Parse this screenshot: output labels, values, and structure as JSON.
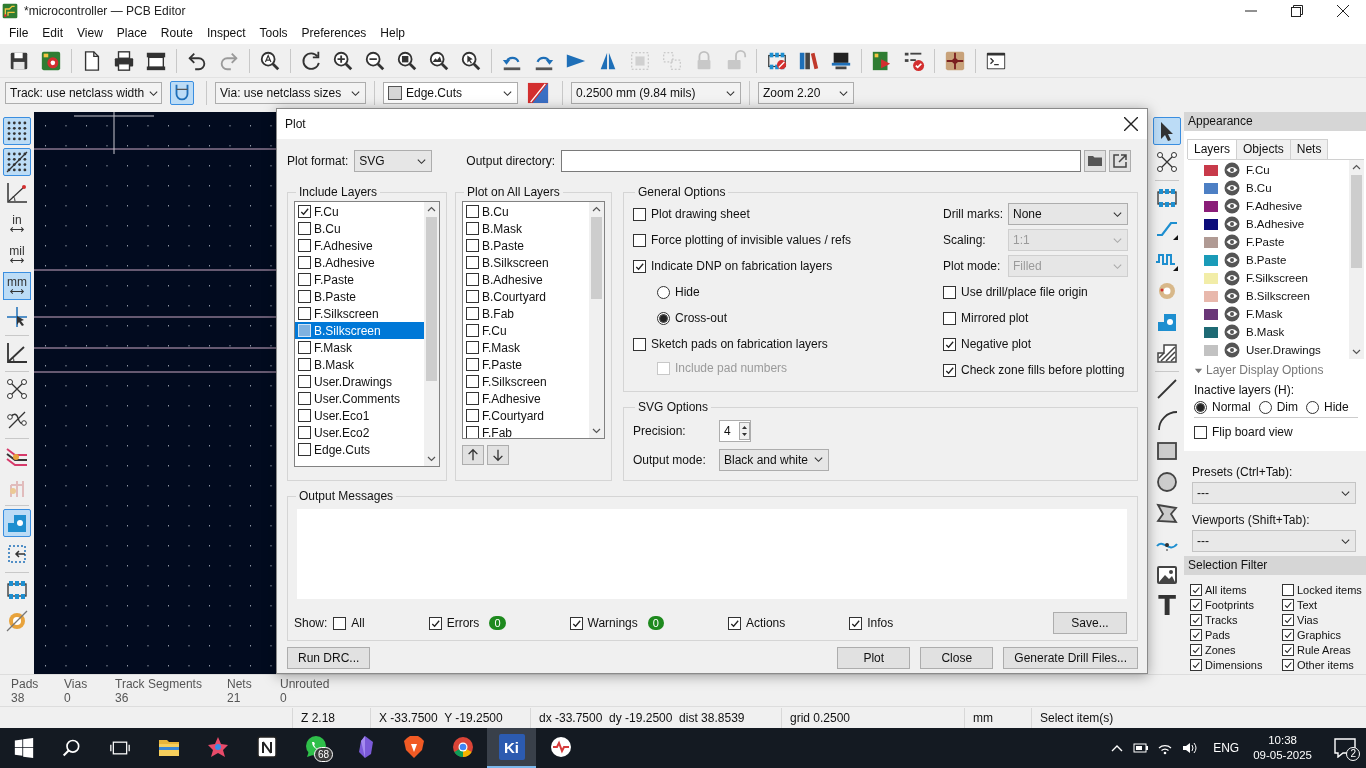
{
  "window": {
    "title": "*microcontroller — PCB Editor"
  },
  "menu": [
    "File",
    "Edit",
    "View",
    "Place",
    "Route",
    "Inspect",
    "Tools",
    "Preferences",
    "Help"
  ],
  "main_toolbar": {
    "groups": [
      {
        "tools": [
          {
            "kind": "save",
            "disabled": false
          },
          {
            "kind": "board-setup",
            "disabled": false
          }
        ]
      },
      {
        "tools": [
          {
            "kind": "page",
            "disabled": false
          },
          {
            "kind": "print",
            "disabled": false
          },
          {
            "kind": "plot",
            "disabled": false
          }
        ]
      },
      {
        "tools": [
          {
            "kind": "undo",
            "disabled": false
          },
          {
            "kind": "redo",
            "disabled": true
          }
        ]
      },
      {
        "tools": [
          {
            "kind": "find",
            "disabled": false
          }
        ]
      },
      {
        "tools": [
          {
            "kind": "refresh",
            "disabled": false
          },
          {
            "kind": "zoom-in",
            "disabled": false
          },
          {
            "kind": "zoom-out",
            "disabled": false
          },
          {
            "kind": "zoom-fit",
            "disabled": false
          },
          {
            "kind": "zoom-objects",
            "disabled": false
          },
          {
            "kind": "zoom-selection",
            "disabled": false
          }
        ]
      },
      {
        "tools": [
          {
            "kind": "rotate-ccw",
            "disabled": false
          },
          {
            "kind": "rotate-cw",
            "disabled": false
          },
          {
            "kind": "flip",
            "disabled": false
          },
          {
            "kind": "mirror",
            "disabled": false
          },
          {
            "kind": "group",
            "disabled": true
          },
          {
            "kind": "ungroup",
            "disabled": true
          },
          {
            "kind": "lock",
            "disabled": true
          },
          {
            "kind": "unlock",
            "disabled": true
          }
        ]
      },
      {
        "tools": [
          {
            "kind": "footprint-editor",
            "disabled": false
          },
          {
            "kind": "library",
            "disabled": false
          },
          {
            "kind": "board-3d",
            "disabled": false
          }
        ]
      },
      {
        "tools": [
          {
            "kind": "update",
            "disabled": false
          },
          {
            "kind": "drc",
            "disabled": false
          }
        ]
      },
      {
        "tools": [
          {
            "kind": "net",
            "disabled": false
          }
        ]
      },
      {
        "tools": [
          {
            "kind": "terminal",
            "disabled": false
          }
        ]
      }
    ]
  },
  "options_bar": {
    "track_width": "Track: use netclass width",
    "posture_on": true,
    "via_size": "Via: use netclass sizes",
    "layer": "Edge.Cuts",
    "grid": "0.2500 mm (9.84 mils)",
    "zoom": "Zoom 2.20"
  },
  "left_toolbar": {
    "groups": [
      {
        "tools": [
          {
            "kind": "grid",
            "on": true
          },
          {
            "kind": "grid-override",
            "on": true
          },
          {
            "kind": "polar",
            "on": false
          },
          {
            "kind": "unit",
            "label": "in",
            "on": false
          },
          {
            "kind": "unit",
            "label": "mil",
            "on": false
          },
          {
            "kind": "unit",
            "label": "mm",
            "on": true
          },
          {
            "kind": "crosshair",
            "on": false
          }
        ]
      },
      {
        "tools": [
          {
            "kind": "angle",
            "on": false
          }
        ]
      },
      {
        "tools": [
          {
            "kind": "ratsnest",
            "on": false
          },
          {
            "kind": "curved-ratsnest",
            "on": false
          }
        ]
      },
      {
        "tools": [
          {
            "kind": "net-colors",
            "on": false
          },
          {
            "kind": "tracks-faded",
            "on": false
          }
        ]
      },
      {
        "tools": [
          {
            "kind": "pads",
            "on": true
          },
          {
            "kind": "selection-box",
            "on": false
          }
        ]
      },
      {
        "tools": [
          {
            "kind": "footprint-outline",
            "on": false
          },
          {
            "kind": "via-outline",
            "on": false
          }
        ]
      }
    ]
  },
  "right_toolbar": {
    "groups": [
      {
        "tools": [
          {
            "kind": "select",
            "on": true
          },
          {
            "kind": "local-ratsnest",
            "on": false
          }
        ]
      },
      {
        "tools": [
          {
            "kind": "footprint",
            "on": false
          },
          {
            "kind": "route",
            "on": false
          },
          {
            "kind": "tune",
            "on": false
          },
          {
            "kind": "via",
            "on": false
          },
          {
            "kind": "pad",
            "on": false
          },
          {
            "kind": "zone",
            "on": false
          }
        ]
      },
      {
        "tools": [
          {
            "kind": "line",
            "on": false
          },
          {
            "kind": "arc",
            "on": false
          },
          {
            "kind": "rect",
            "on": false
          },
          {
            "kind": "circle",
            "on": false
          },
          {
            "kind": "polygon",
            "on": false
          },
          {
            "kind": "bezier",
            "on": false
          },
          {
            "kind": "image",
            "on": false
          },
          {
            "kind": "text",
            "label": "T",
            "on": false
          }
        ]
      }
    ]
  },
  "appearance": {
    "title": "Appearance",
    "tabs": [
      {
        "label": "Layers",
        "selected": true
      },
      {
        "label": "Objects",
        "selected": false
      },
      {
        "label": "Nets",
        "selected": false
      }
    ],
    "layers": [
      {
        "name": "F.Cu",
        "color": "#c83a4a",
        "visible": true
      },
      {
        "name": "B.Cu",
        "color": "#4d7fc4",
        "visible": true
      },
      {
        "name": "F.Adhesive",
        "color": "#8a1d78",
        "visible": true
      },
      {
        "name": "B.Adhesive",
        "color": "#0c0c7a",
        "visible": true
      },
      {
        "name": "F.Paste",
        "color": "#b09a94",
        "visible": true
      },
      {
        "name": "B.Paste",
        "color": "#1a9bb8",
        "visible": true
      },
      {
        "name": "F.Silkscreen",
        "color": "#f2eda8",
        "visible": true
      },
      {
        "name": "B.Silkscreen",
        "color": "#e8b8ac",
        "visible": true
      },
      {
        "name": "F.Mask",
        "color": "#6a3778",
        "visible": true
      },
      {
        "name": "B.Mask",
        "color": "#1e6a74",
        "visible": true
      },
      {
        "name": "User.Drawings",
        "color": "#c2c2c2",
        "visible": true
      }
    ],
    "display_options": {
      "title": "Layer Display Options",
      "expanded": true,
      "inactive_label": "Inactive layers (H):",
      "inactive_modes": [
        {
          "label": "Normal",
          "selected": true
        },
        {
          "label": "Dim",
          "selected": false
        },
        {
          "label": "Hide",
          "selected": false
        }
      ],
      "flip": {
        "label": "Flip board view",
        "checked": false
      }
    },
    "presets": {
      "label": "Presets (Ctrl+Tab):",
      "value": "---"
    },
    "viewports": {
      "label": "Viewports (Shift+Tab):",
      "value": "---"
    }
  },
  "selection_filter": {
    "title": "Selection Filter",
    "items": [
      {
        "label": "All items",
        "checked": true
      },
      {
        "label": "Locked items",
        "checked": false
      },
      {
        "label": "Footprints",
        "checked": true
      },
      {
        "label": "Text",
        "checked": true
      },
      {
        "label": "Tracks",
        "checked": true
      },
      {
        "label": "Vias",
        "checked": true
      },
      {
        "label": "Pads",
        "checked": true
      },
      {
        "label": "Graphics",
        "checked": true
      },
      {
        "label": "Zones",
        "checked": true
      },
      {
        "label": "Rule Areas",
        "checked": true
      },
      {
        "label": "Dimensions",
        "checked": true
      },
      {
        "label": "Other items",
        "checked": true
      }
    ]
  },
  "plot_dialog": {
    "title": "Plot",
    "format_label": "Plot format:",
    "format": "SVG",
    "output_dir_label": "Output directory:",
    "include_layers": {
      "title": "Include Layers",
      "items": [
        {
          "name": "F.Cu",
          "checked": true,
          "selected": false
        },
        {
          "name": "B.Cu",
          "checked": false,
          "selected": false
        },
        {
          "name": "F.Adhesive",
          "checked": false,
          "selected": false
        },
        {
          "name": "B.Adhesive",
          "checked": false,
          "selected": false
        },
        {
          "name": "F.Paste",
          "checked": false,
          "selected": false
        },
        {
          "name": "B.Paste",
          "checked": false,
          "selected": false
        },
        {
          "name": "F.Silkscreen",
          "checked": false,
          "selected": false
        },
        {
          "name": "B.Silkscreen",
          "checked": false,
          "selected": true
        },
        {
          "name": "F.Mask",
          "checked": false,
          "selected": false
        },
        {
          "name": "B.Mask",
          "checked": false,
          "selected": false
        },
        {
          "name": "User.Drawings",
          "checked": false,
          "selected": false
        },
        {
          "name": "User.Comments",
          "checked": false,
          "selected": false
        },
        {
          "name": "User.Eco1",
          "checked": false,
          "selected": false
        },
        {
          "name": "User.Eco2",
          "checked": false,
          "selected": false
        },
        {
          "name": "Edge.Cuts",
          "checked": false,
          "selected": false
        }
      ]
    },
    "all_layers": {
      "title": "Plot on All Layers",
      "items": [
        {
          "name": "B.Cu",
          "checked": false
        },
        {
          "name": "B.Mask",
          "checked": false
        },
        {
          "name": "B.Paste",
          "checked": false
        },
        {
          "name": "B.Silkscreen",
          "checked": false
        },
        {
          "name": "B.Adhesive",
          "checked": false
        },
        {
          "name": "B.Courtyard",
          "checked": false
        },
        {
          "name": "B.Fab",
          "checked": false
        },
        {
          "name": "F.Cu",
          "checked": false
        },
        {
          "name": "F.Mask",
          "checked": false
        },
        {
          "name": "F.Paste",
          "checked": false
        },
        {
          "name": "F.Silkscreen",
          "checked": false
        },
        {
          "name": "F.Adhesive",
          "checked": false
        },
        {
          "name": "F.Courtyard",
          "checked": false
        },
        {
          "name": "F.Fab",
          "checked": false
        }
      ]
    },
    "general": {
      "title": "General Options",
      "options": [
        {
          "kind": "checkbox",
          "label": "Plot drawing sheet",
          "checked": false,
          "disabled": false
        },
        {
          "kind": "checkbox",
          "label": "Force plotting of invisible values / refs",
          "checked": false,
          "disabled": false
        },
        {
          "kind": "checkbox",
          "label": "Indicate DNP on fabrication layers",
          "checked": true,
          "disabled": false,
          "children": [
            {
              "kind": "radio",
              "label": "Hide",
              "selected": false,
              "disabled": false
            },
            {
              "kind": "radio",
              "label": "Cross-out",
              "selected": true,
              "disabled": false
            }
          ]
        },
        {
          "kind": "checkbox",
          "label": "Sketch pads on fabrication layers",
          "checked": false,
          "disabled": false,
          "children": [
            {
              "kind": "checkbox",
              "label": "Include pad numbers",
              "checked": false,
              "disabled": true
            }
          ]
        }
      ],
      "fields": [
        {
          "label": "Drill marks:",
          "value": "None",
          "disabled": false
        },
        {
          "label": "Scaling:",
          "value": "1:1",
          "disabled": true
        },
        {
          "label": "Plot mode:",
          "value": "Filled",
          "disabled": true
        }
      ],
      "right_options": [
        {
          "label": "Use drill/place file origin",
          "checked": false
        },
        {
          "label": "Mirrored plot",
          "checked": false
        },
        {
          "label": "Negative plot",
          "checked": true
        },
        {
          "label": "Check zone fills before plotting",
          "checked": true
        }
      ]
    },
    "svg": {
      "title": "SVG Options",
      "precision_label": "Precision:",
      "precision": "4",
      "output_mode_label": "Output mode:",
      "output_mode": "Black and white"
    },
    "messages": {
      "title": "Output Messages",
      "show_label": "Show:",
      "filters": [
        {
          "label": "All",
          "checked": false
        },
        {
          "label": "Errors",
          "checked": true,
          "count": "0"
        },
        {
          "label": "Warnings",
          "checked": true,
          "count": "0"
        },
        {
          "label": "Actions",
          "checked": true
        },
        {
          "label": "Infos",
          "checked": true
        }
      ],
      "save": "Save..."
    },
    "buttons_left": [
      "Run DRC..."
    ],
    "buttons_right": [
      "Plot",
      "Close",
      "Generate Drill Files..."
    ]
  },
  "message_panel": [
    {
      "label": "Pads",
      "value": "38"
    },
    {
      "label": "Vias",
      "value": "0"
    },
    {
      "label": "Track Segments",
      "value": "36"
    },
    {
      "label": "Nets",
      "value": "21"
    },
    {
      "label": "Unrouted",
      "value": "0"
    }
  ],
  "status_bar": [
    "Z 2.18",
    "X -33.7500  Y -19.2500",
    "dx -33.7500  dy -19.2500  dist 38.8539",
    "grid 0.2500",
    "mm",
    "Select item(s)"
  ],
  "taskbar": {
    "apps": [
      {
        "kind": "folder",
        "active": false
      },
      {
        "kind": "spark",
        "active": false
      },
      {
        "kind": "notion",
        "active": false
      },
      {
        "kind": "whatsapp",
        "active": false,
        "badge": "68"
      },
      {
        "kind": "obsidian",
        "active": false
      },
      {
        "kind": "brave",
        "active": false
      },
      {
        "kind": "chrome",
        "active": false
      },
      {
        "kind": "kicad",
        "active": true,
        "label": "Ki"
      },
      {
        "kind": "heartbeat",
        "active": false
      }
    ],
    "language": "ENG",
    "time": "10:38",
    "date": "09-05-2025",
    "notifications": "2"
  }
}
